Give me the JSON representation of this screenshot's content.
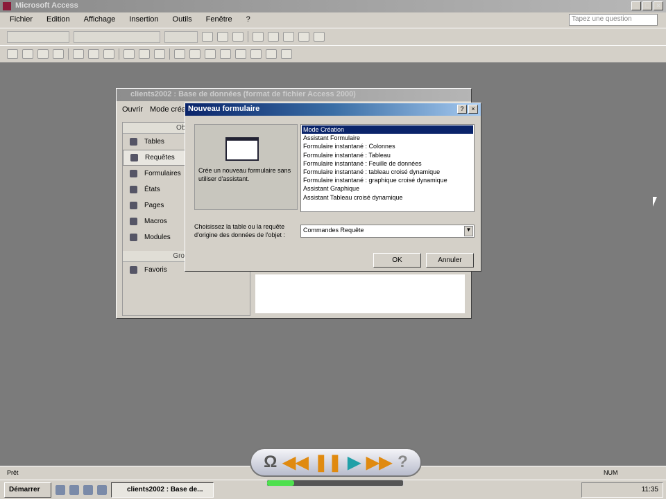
{
  "app": {
    "title": "Microsoft Access"
  },
  "menu": [
    "Fichier",
    "Edition",
    "Affichage",
    "Insertion",
    "Outils",
    "Fenêtre",
    "?"
  ],
  "ask_placeholder": "Tapez une question",
  "dbwindow": {
    "title": "clients2002 : Base de données (format de fichier Access 2000)",
    "toolbar": [
      "Ouvrir",
      "Mode création"
    ],
    "objects_header": "Objets",
    "objects": [
      "Tables",
      "Requêtes",
      "Formulaires",
      "États",
      "Pages",
      "Macros",
      "Modules"
    ],
    "selected": "Requêtes",
    "groups_header": "Groupes",
    "groups": [
      "Favoris"
    ]
  },
  "dialog": {
    "title": "Nouveau formulaire",
    "description": "Crée un nouveau formulaire sans utiliser d'assistant.",
    "options": [
      "Mode Création",
      "Assistant Formulaire",
      "Formulaire instantané : Colonnes",
      "Formulaire instantané : Tableau",
      "Formulaire instantané : Feuille de données",
      "Formulaire instantané : tableau croisé dynamique",
      "Formulaire instantané : graphique croisé dynamique",
      "Assistant Graphique",
      "Assistant Tableau croisé dynamique"
    ],
    "selected_index": 0,
    "source_label": "Choisissez la table ou la requête d'origine des données de l'objet :",
    "source_value": "Commandes Requête",
    "ok": "OK",
    "cancel": "Annuler"
  },
  "status": {
    "left": "Prêt",
    "num": "NUM"
  },
  "taskbar": {
    "start": "Démarrer",
    "task": "clients2002 : Base de...",
    "clock": "11:35"
  },
  "player": {
    "progress": 0.2
  }
}
